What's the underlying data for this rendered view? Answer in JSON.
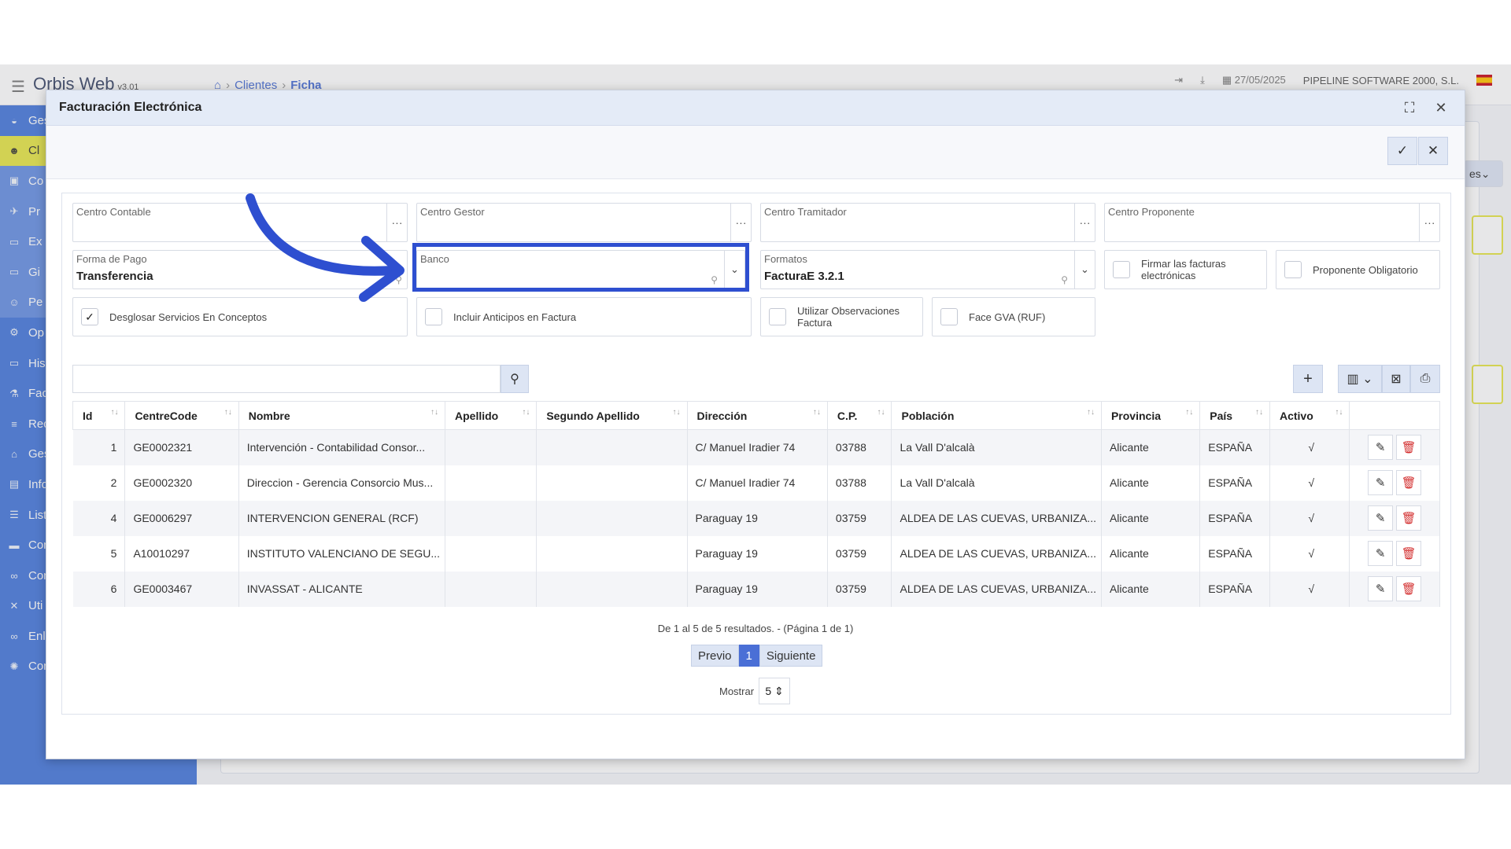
{
  "app": {
    "brand": "Orbis Web",
    "version": "v3.01",
    "breadcrumbs": [
      "Clientes",
      "Ficha"
    ],
    "date": "27/05/2025",
    "company": "PIPELINE SOFTWARE 2000, S.L.",
    "sidebar": [
      {
        "label": "Ges",
        "icon": "car-icon"
      },
      {
        "label": "Cl",
        "icon": "users-icon"
      },
      {
        "label": "Co",
        "icon": "id-card-icon"
      },
      {
        "label": "Pr",
        "icon": "rocket-icon"
      },
      {
        "label": "Ex",
        "icon": "folder-icon"
      },
      {
        "label": "Gi",
        "icon": "folder-icon"
      },
      {
        "label": "Pe",
        "icon": "user-icon"
      },
      {
        "label": "Op",
        "icon": "network-icon"
      },
      {
        "label": "His",
        "icon": "folder-icon"
      },
      {
        "label": "Fac",
        "icon": "flask-icon"
      },
      {
        "label": "Rec",
        "icon": "receipt-icon"
      },
      {
        "label": "Ges",
        "icon": "bank-icon"
      },
      {
        "label": "Info",
        "icon": "report-icon"
      },
      {
        "label": "List",
        "icon": "list-icon"
      },
      {
        "label": "Con",
        "icon": "card-icon"
      },
      {
        "label": "Con",
        "icon": "link-icon"
      },
      {
        "label": "Uti",
        "icon": "tools-icon"
      },
      {
        "label": "Enl",
        "icon": "link-icon"
      },
      {
        "label": "Con",
        "icon": "gear-icon"
      }
    ],
    "right_button": "es"
  },
  "modal": {
    "title": "Facturación Electrónica",
    "fields": {
      "centro_contable": {
        "label": "Centro Contable",
        "value": ""
      },
      "centro_gestor": {
        "label": "Centro Gestor",
        "value": ""
      },
      "centro_tramitador": {
        "label": "Centro Tramitador",
        "value": ""
      },
      "centro_proponente": {
        "label": "Centro Proponente",
        "value": ""
      },
      "forma_pago": {
        "label": "Forma de Pago",
        "value": "Transferencia"
      },
      "banco": {
        "label": "Banco",
        "value": ""
      },
      "formatos": {
        "label": "Formatos",
        "value": "FacturaE 3.2.1"
      }
    },
    "checks": {
      "firmar": {
        "label": "Firmar las facturas electrónicas",
        "checked": false
      },
      "proponente": {
        "label": "Proponente Obligatorio",
        "checked": false
      },
      "desglosar": {
        "label": "Desglosar Servicios En Conceptos",
        "checked": true
      },
      "anticipos": {
        "label": "Incluir Anticipos en Factura",
        "checked": false
      },
      "observaciones": {
        "label": "Utilizar Observaciones Factura",
        "checked": false
      },
      "face": {
        "label": "Face GVA (RUF)",
        "checked": false
      }
    },
    "table": {
      "columns": [
        "Id",
        "CentreCode",
        "Nombre",
        "Apellido",
        "Segundo Apellido",
        "Dirección",
        "C.P.",
        "Población",
        "Provincia",
        "País",
        "Activo"
      ],
      "rows": [
        {
          "id": "1",
          "code": "GE0002321",
          "nombre": "Intervención - Contabilidad Consor...",
          "apellido": "",
          "segundo": "",
          "direccion": "C/ Manuel Iradier 74",
          "cp": "03788",
          "poblacion": "La Vall D'alcalà",
          "provincia": "Alicante",
          "pais": "ESPAÑA",
          "activo": "√"
        },
        {
          "id": "2",
          "code": "GE0002320",
          "nombre": "Direccion - Gerencia Consorcio Mus...",
          "apellido": "",
          "segundo": "",
          "direccion": "C/ Manuel Iradier 74",
          "cp": "03788",
          "poblacion": "La Vall D'alcalà",
          "provincia": "Alicante",
          "pais": "ESPAÑA",
          "activo": "√"
        },
        {
          "id": "4",
          "code": "GE0006297",
          "nombre": "INTERVENCION GENERAL (RCF)",
          "apellido": "",
          "segundo": "",
          "direccion": "Paraguay 19",
          "cp": "03759",
          "poblacion": "ALDEA DE LAS CUEVAS, URBANIZA...",
          "provincia": "Alicante",
          "pais": "ESPAÑA",
          "activo": "√"
        },
        {
          "id": "5",
          "code": "A10010297",
          "nombre": "INSTITUTO VALENCIANO DE SEGU...",
          "apellido": "",
          "segundo": "",
          "direccion": "Paraguay 19",
          "cp": "03759",
          "poblacion": "ALDEA DE LAS CUEVAS, URBANIZA...",
          "provincia": "Alicante",
          "pais": "ESPAÑA",
          "activo": "√"
        },
        {
          "id": "6",
          "code": "GE0003467",
          "nombre": "INVASSAT - ALICANTE",
          "apellido": "",
          "segundo": "",
          "direccion": "Paraguay 19",
          "cp": "03759",
          "poblacion": "ALDEA DE LAS CUEVAS, URBANIZA...",
          "provincia": "Alicante",
          "pais": "ESPAÑA",
          "activo": "√"
        }
      ]
    },
    "pager": {
      "info": "De 1 al 5 de 5 resultados. - (Página 1 de 1)",
      "prev": "Previo",
      "current": "1",
      "next": "Siguiente",
      "show_label": "Mostrar",
      "page_size": "5"
    }
  },
  "colors": {
    "accent": "#4a6fd6",
    "sidebar": "#4a7bdc",
    "highlight": "#2e4fd0",
    "delete": "#d32f2f"
  }
}
